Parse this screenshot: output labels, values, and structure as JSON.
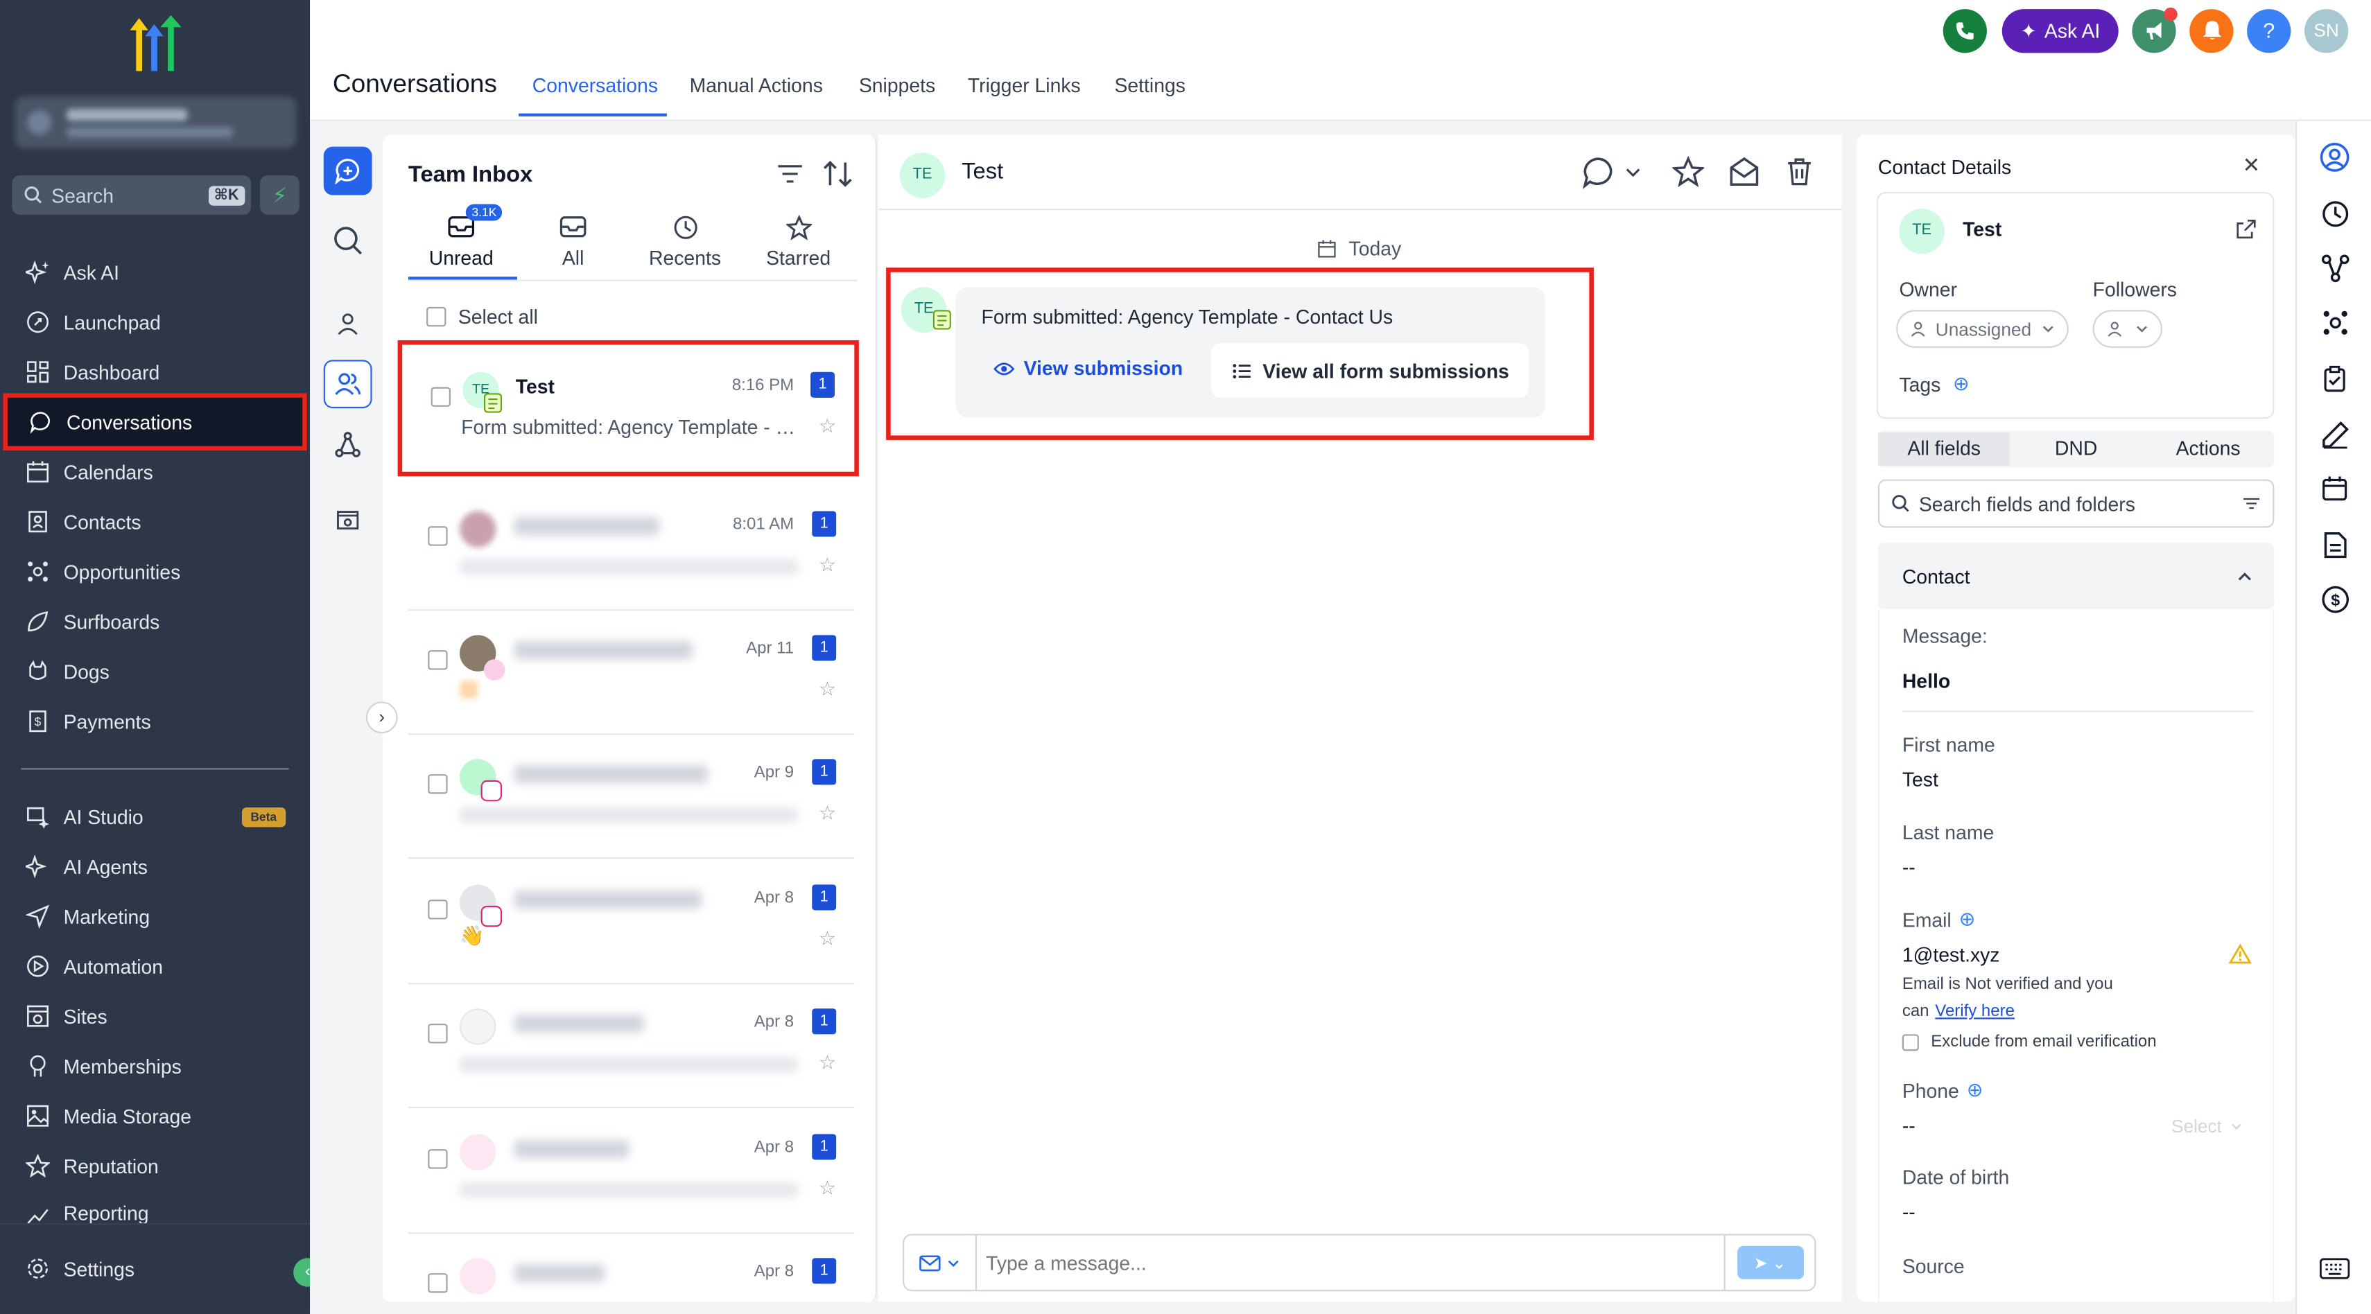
{
  "sidebar": {
    "search_placeholder": "Search",
    "search_shortcut": "⌘K",
    "items": [
      {
        "label": "Ask AI",
        "icon": "sparkle-icon"
      },
      {
        "label": "Launchpad",
        "icon": "rocket-icon"
      },
      {
        "label": "Dashboard",
        "icon": "grid-icon"
      },
      {
        "label": "Conversations",
        "icon": "chat-icon"
      },
      {
        "label": "Calendars",
        "icon": "calendar-icon"
      },
      {
        "label": "Contacts",
        "icon": "contacts-icon"
      },
      {
        "label": "Opportunities",
        "icon": "pipeline-icon"
      },
      {
        "label": "Surfboards",
        "icon": "surfboard-icon"
      },
      {
        "label": "Dogs",
        "icon": "dog-icon"
      },
      {
        "label": "Payments",
        "icon": "receipt-icon"
      }
    ],
    "items2": [
      {
        "label": "AI Studio",
        "icon": "ai-studio-icon",
        "badge": "Beta"
      },
      {
        "label": "AI Agents",
        "icon": "agents-icon"
      },
      {
        "label": "Marketing",
        "icon": "send-icon"
      },
      {
        "label": "Automation",
        "icon": "automation-icon"
      },
      {
        "label": "Sites",
        "icon": "sites-icon"
      },
      {
        "label": "Memberships",
        "icon": "membership-icon"
      },
      {
        "label": "Media Storage",
        "icon": "media-icon"
      },
      {
        "label": "Reputation",
        "icon": "star-icon"
      },
      {
        "label": "Reporting",
        "icon": "chart-icon"
      }
    ],
    "settings_label": "Settings"
  },
  "topbar": {
    "page_title": "Conversations",
    "tabs": [
      "Conversations",
      "Manual Actions",
      "Snippets",
      "Trigger Links",
      "Settings"
    ],
    "ask_ai": "Ask AI",
    "help": "?",
    "user_initials": "SN"
  },
  "inbox": {
    "title": "Team Inbox",
    "filters": [
      "Unread",
      "All",
      "Recents",
      "Starred"
    ],
    "unread_badge": "3.1K",
    "select_all": "Select all",
    "conversations": [
      {
        "name": "Test",
        "time": "8:16 PM",
        "count": "1",
        "preview": "Form submitted: Agency Template - Contact Us",
        "initials": "TE"
      },
      {
        "time": "8:01 AM",
        "count": "1"
      },
      {
        "time": "Apr 11",
        "count": "1"
      },
      {
        "time": "Apr 9",
        "count": "1"
      },
      {
        "time": "Apr 8",
        "count": "1",
        "preview_emoji": "👋"
      },
      {
        "time": "Apr 8",
        "count": "1"
      },
      {
        "time": "Apr 8",
        "count": "1"
      },
      {
        "time": "Apr 8",
        "count": "1"
      }
    ]
  },
  "chat": {
    "contact_initials": "TE",
    "contact_name": "Test",
    "date_divider": "Today",
    "message_text": "Form submitted: Agency Template - Contact Us",
    "view_submission": "View submission",
    "view_all": "View all form submissions",
    "composer_placeholder": "Type a message..."
  },
  "contact": {
    "title": "Contact Details",
    "initials": "TE",
    "name": "Test",
    "owner_label": "Owner",
    "owner_value": "Unassigned",
    "followers_label": "Followers",
    "tags_label": "Tags",
    "segments": [
      "All fields",
      "DND",
      "Actions"
    ],
    "search_placeholder": "Search fields and folders",
    "section": "Contact",
    "fields": {
      "message_label": "Message:",
      "message_value": "Hello",
      "first_name_label": "First name",
      "first_name_value": "Test",
      "last_name_label": "Last name",
      "last_name_value": "--",
      "email_label": "Email",
      "email_value": "1@test.xyz",
      "email_note1": "Email is Not verified and you",
      "email_note2": "can",
      "verify_link": "Verify here",
      "exclude_label": "Exclude from email verification",
      "phone_label": "Phone",
      "phone_value": "--",
      "phone_select": "Select",
      "dob_label": "Date of birth",
      "dob_value": "--",
      "source_label": "Source"
    }
  },
  "colors": {
    "sidebar_bg": "#2d3748",
    "accent": "#2563eb",
    "highlight": "#e8221b",
    "ask_ai": "#5b21b6"
  }
}
